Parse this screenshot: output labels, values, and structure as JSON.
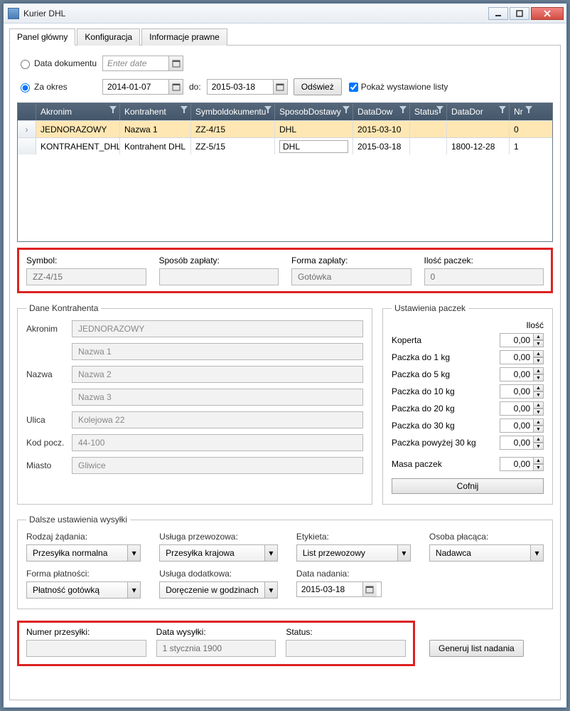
{
  "window": {
    "title": "Kurier DHL"
  },
  "tabs": {
    "main": "Panel główny",
    "config": "Konfiguracja",
    "legal": "Informacje prawne"
  },
  "filters": {
    "docdate_label": "Data dokumentu",
    "docdate_placeholder": "Enter date",
    "period_label": "Za okres",
    "date_from": "2014-01-07",
    "date_to_label": "do:",
    "date_to": "2015-03-18",
    "refresh": "Odśwież",
    "show_issued": "Pokaż wystawione listy"
  },
  "grid": {
    "headers": {
      "akronim": "Akronim",
      "kontrahent": "Kontrahent",
      "symbol": "Symboldokumentu",
      "sposob": "SposobDostawy",
      "datadow": "DataDow",
      "status": "Status",
      "datador": "DataDor",
      "nr": "Nr"
    },
    "rows": [
      {
        "akronim": "JEDNORAZOWY",
        "kontrahent": "Nazwa 1",
        "symbol": "ZZ-4/15",
        "sposob": "DHL",
        "datadow": "2015-03-10",
        "status": "",
        "datador": "",
        "nr": "0",
        "selected": true
      },
      {
        "akronim": "KONTRAHENT_DHL",
        "kontrahent": "Kontrahent DHL",
        "symbol": "ZZ-5/15",
        "sposob": "DHL",
        "datadow": "2015-03-18",
        "status": "",
        "datador": "1800-12-28",
        "nr": "1",
        "editable_sposob": true
      }
    ]
  },
  "summary": {
    "symbol_label": "Symbol:",
    "symbol": "ZZ-4/15",
    "payway_label": "Sposób zapłaty:",
    "payway": "",
    "payform_label": "Forma zapłaty:",
    "payform": "Gotówka",
    "pkg_label": "Ilość paczek:",
    "pkg": "0"
  },
  "contractor": {
    "legend": "Dane Kontrahenta",
    "akronim_label": "Akronim",
    "akronim": "JEDNORAZOWY",
    "nazwa_label": "Nazwa",
    "n1": "Nazwa 1",
    "n2": "Nazwa 2",
    "n3": "Nazwa 3",
    "ulica_label": "Ulica",
    "ulica": "Kolejowa 22",
    "kod_label": "Kod pocz.",
    "kod": "44-100",
    "miasto_label": "Miasto",
    "miasto": "Gliwice"
  },
  "pkg": {
    "legend": "Ustawienia paczek",
    "qty_header": "Ilość",
    "items": [
      {
        "label": "Koperta",
        "val": "0,00"
      },
      {
        "label": "Paczka do 1 kg",
        "val": "0,00"
      },
      {
        "label": "Paczka do 5 kg",
        "val": "0,00"
      },
      {
        "label": "Paczka do 10 kg",
        "val": "0,00"
      },
      {
        "label": "Paczka do 20 kg",
        "val": "0,00"
      },
      {
        "label": "Paczka do 30 kg",
        "val": "0,00"
      },
      {
        "label": "Paczka powyżej 30 kg",
        "val": "0,00"
      }
    ],
    "mass_label": "Masa paczek",
    "mass": "0,00",
    "undo": "Cofnij"
  },
  "ship": {
    "legend": "Dalsze ustawienia wysyłki",
    "reqtype_label": "Rodzaj żądania:",
    "reqtype": "Przesyłka normalna",
    "service_label": "Usługa przewozowa:",
    "service": "Przesyłka krajowa",
    "label_label": "Etykieta:",
    "label_val": "List przewozowy",
    "payer_label": "Osoba płacąca:",
    "payer": "Nadawca",
    "payform_label": "Forma płatności:",
    "payform": "Płatność gotówką",
    "addon_label": "Usługa dodatkowa:",
    "addon": "Doręczenie w godzinach",
    "senddate_label": "Data nadania:",
    "senddate": "2015-03-18"
  },
  "bottom": {
    "num_label": "Numer przesyłki:",
    "num": "",
    "date_label": "Data wysyłki:",
    "date": "1 stycznia 1900",
    "status_label": "Status:",
    "status": "",
    "generate": "Generuj list nadania"
  }
}
